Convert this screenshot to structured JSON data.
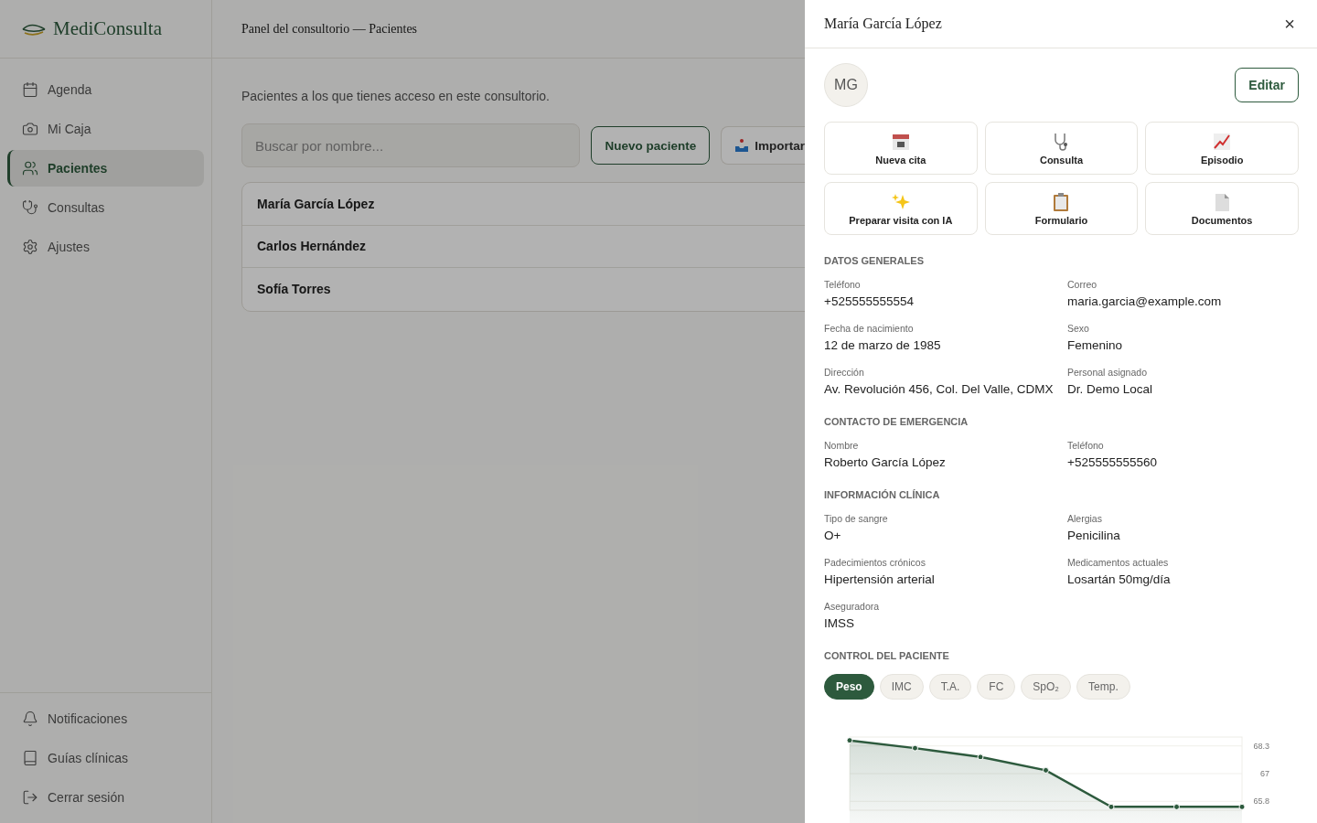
{
  "brand": {
    "name": "MediConsulta"
  },
  "header": {
    "title": "Panel del consultorio — Pacientes"
  },
  "sidebar": {
    "items": [
      {
        "label": "Agenda",
        "selected": false
      },
      {
        "label": "Mi Caja",
        "selected": false
      },
      {
        "label": "Pacientes",
        "selected": true
      },
      {
        "label": "Consultas",
        "selected": false
      },
      {
        "label": "Ajustes",
        "selected": false
      }
    ],
    "footer_items": [
      {
        "label": "Notificaciones"
      },
      {
        "label": "Guías clínicas"
      },
      {
        "label": "Cerrar sesión"
      }
    ]
  },
  "main": {
    "description": "Pacientes a los que tienes acceso en este consultorio.",
    "search": {
      "placeholder": "Buscar por nombre..."
    },
    "buttons": [
      {
        "label": "Nuevo paciente",
        "kind": "primary"
      },
      {
        "label": "Importar",
        "kind": "import"
      }
    ],
    "patients": [
      {
        "name": "María García López"
      },
      {
        "name": "Carlos Hernández"
      },
      {
        "name": "Sofía Torres"
      }
    ]
  },
  "drawer": {
    "title": "María García López",
    "close": "×",
    "avatar": "MG",
    "edit": "Editar",
    "actions": [
      {
        "label": "Nueva cita"
      },
      {
        "label": "Consulta"
      },
      {
        "label": "Episodio"
      },
      {
        "label": "Preparar visita con IA"
      },
      {
        "label": "Formulario"
      },
      {
        "label": "Documentos"
      }
    ],
    "sections": [
      {
        "title": "DATOS GENERALES",
        "fields": [
          {
            "label": "Teléfono",
            "value": "+525555555554"
          },
          {
            "label": "Correo",
            "value": "maria.garcia@example.com"
          },
          {
            "label": "Fecha de nacimiento",
            "value": "12 de marzo de 1985"
          },
          {
            "label": "Sexo",
            "value": "Femenino"
          },
          {
            "label": "Dirección",
            "value": "Av. Revolución 456, Col. Del Valle, CDMX"
          },
          {
            "label": "Personal asignado",
            "value": "Dr. Demo Local"
          }
        ]
      },
      {
        "title": "CONTACTO DE EMERGENCIA",
        "fields": [
          {
            "label": "Nombre",
            "value": "Roberto García López"
          },
          {
            "label": "Teléfono",
            "value": "+525555555560"
          }
        ]
      },
      {
        "title": "INFORMACIÓN CLÍNICA",
        "fields": [
          {
            "label": "Tipo de sangre",
            "value": "O+"
          },
          {
            "label": "Alergias",
            "value": "Penicilina"
          },
          {
            "label": "Padecimientos crónicos",
            "value": "Hipertensión arterial"
          },
          {
            "label": "Medicamentos actuales",
            "value": "Losartán 50mg/día"
          },
          {
            "label": "Aseguradora",
            "value": "IMSS"
          }
        ]
      }
    ],
    "control": {
      "title": "CONTROL DEL PACIENTE",
      "tabs": [
        {
          "label": "Peso",
          "selected": true
        },
        {
          "label": "IMC",
          "selected": false
        },
        {
          "label": "T.A.",
          "selected": false
        },
        {
          "label": "FC",
          "selected": false
        },
        {
          "label": "SpO₂",
          "selected": false
        },
        {
          "label": "Temp.",
          "selected": false
        }
      ],
      "chart_data": {
        "type": "area",
        "ylim": [
          65.4,
          68.7
        ],
        "grid": true,
        "series": [
          {
            "color": "#2d5a3d",
            "values": [
              68.55,
              68.2,
              67.8,
              67.2,
              65.55,
              65.55,
              65.55
            ]
          }
        ],
        "yticks": [
          {
            "value": 68.3,
            "label": "68.3"
          },
          {
            "value": 67.05,
            "label": "67"
          },
          {
            "value": 65.8,
            "label": "65.8"
          }
        ]
      }
    }
  }
}
